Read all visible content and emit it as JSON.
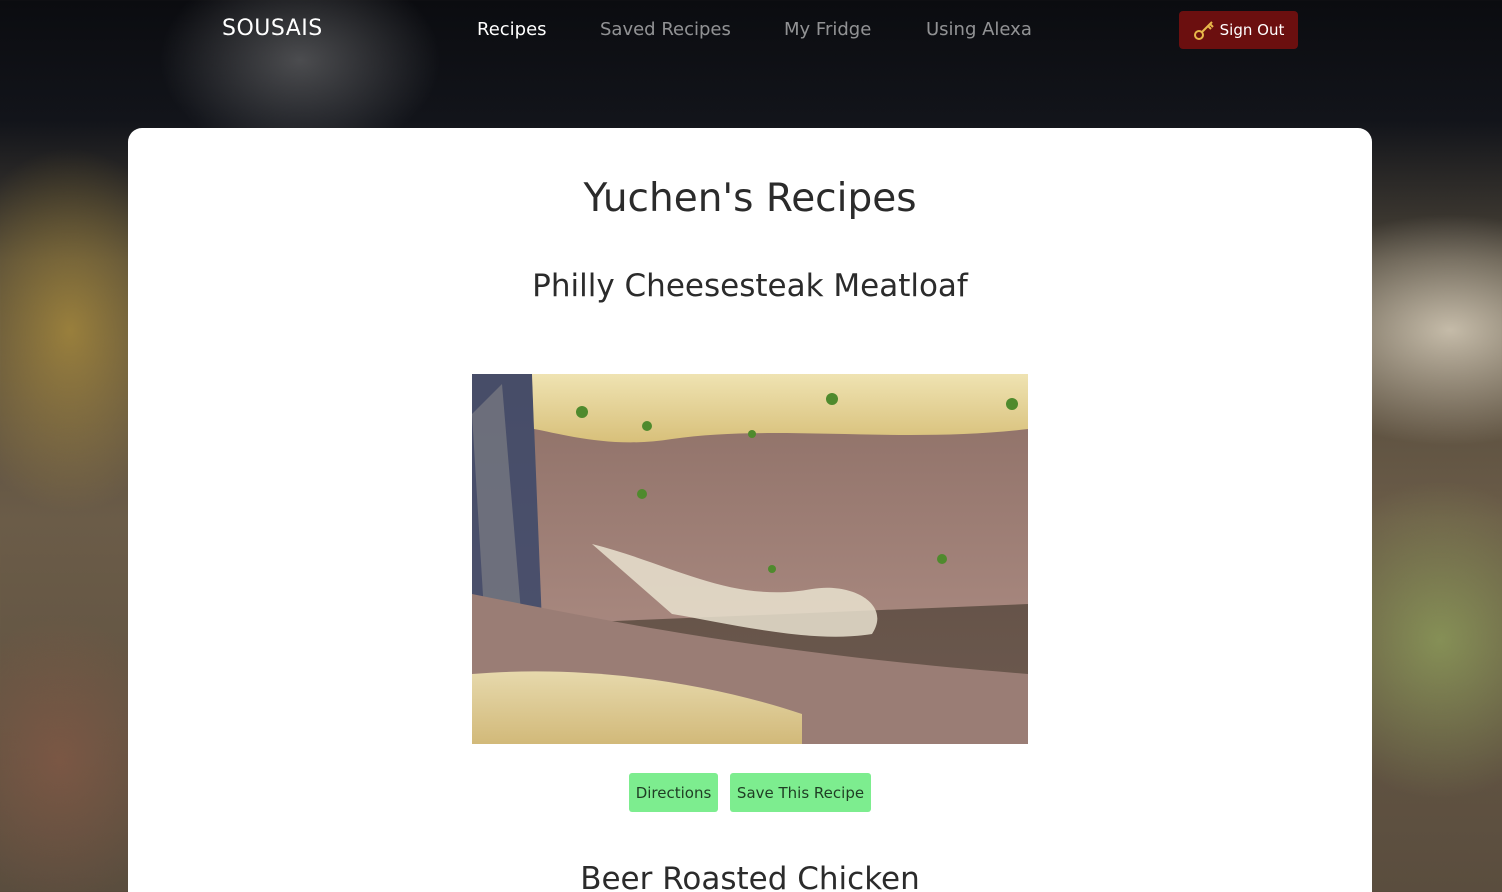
{
  "brand": "SOUSAIS",
  "nav": {
    "items": [
      {
        "label": "Recipes",
        "active": true
      },
      {
        "label": "Saved Recipes",
        "active": false
      },
      {
        "label": "My Fridge",
        "active": false
      },
      {
        "label": "Using Alexa",
        "active": false
      }
    ],
    "sign_out_label": "Sign Out",
    "sign_out_icon": "key-icon"
  },
  "colors": {
    "sign_out_bg": "#6b0f0f",
    "action_button_bg": "#7ded8f",
    "nav_active": "#ffffff"
  },
  "main": {
    "page_title": "Yuchen's Recipes",
    "recipes": [
      {
        "title": "Philly Cheesesteak Meatloaf",
        "image": "meatloaf-photo",
        "directions_label": "Directions",
        "save_label": "Save This Recipe"
      },
      {
        "title": "Beer Roasted Chicken"
      }
    ]
  }
}
